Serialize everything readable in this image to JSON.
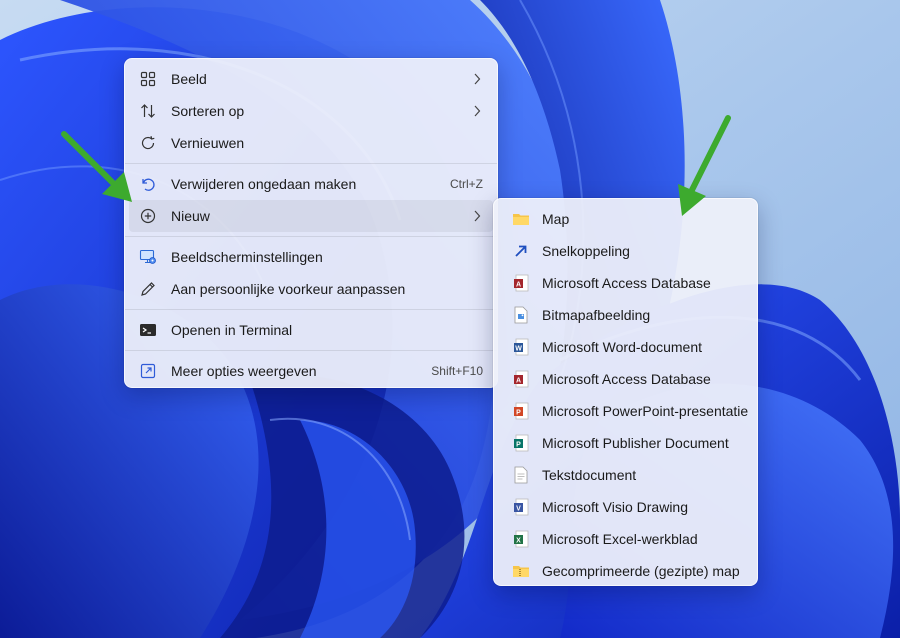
{
  "context_menu": {
    "items": [
      {
        "label": "Beeld",
        "icon": "grid-icon",
        "has_submenu": true
      },
      {
        "label": "Sorteren op",
        "icon": "sort-icon",
        "has_submenu": true
      },
      {
        "label": "Vernieuwen",
        "icon": "refresh-icon"
      },
      {
        "label": "Verwijderen ongedaan maken",
        "icon": "undo-icon",
        "shortcut": "Ctrl+Z"
      },
      {
        "label": "Nieuw",
        "icon": "add-circle-icon",
        "has_submenu": true
      },
      {
        "label": "Beeldscherminstellingen",
        "icon": "display-settings-icon"
      },
      {
        "label": "Aan persoonlijke voorkeur aanpassen",
        "icon": "pencil-icon"
      },
      {
        "label": "Openen in Terminal",
        "icon": "terminal-icon"
      },
      {
        "label": "Meer opties weergeven",
        "icon": "more-options-icon",
        "shortcut": "Shift+F10"
      }
    ]
  },
  "new_submenu": {
    "items": [
      {
        "label": "Map",
        "icon": "folder-icon"
      },
      {
        "label": "Snelkoppeling",
        "icon": "shortcut-icon"
      },
      {
        "label": "Microsoft Access Database",
        "icon": "access-icon"
      },
      {
        "label": "Bitmapafbeelding",
        "icon": "bitmap-icon"
      },
      {
        "label": "Microsoft Word-document",
        "icon": "word-icon"
      },
      {
        "label": "Microsoft Access Database",
        "icon": "access-icon"
      },
      {
        "label": "Microsoft PowerPoint-presentatie",
        "icon": "powerpoint-icon"
      },
      {
        "label": "Microsoft Publisher Document",
        "icon": "publisher-icon"
      },
      {
        "label": "Tekstdocument",
        "icon": "text-document-icon"
      },
      {
        "label": "Microsoft Visio Drawing",
        "icon": "visio-icon"
      },
      {
        "label": "Microsoft Excel-werkblad",
        "icon": "excel-icon"
      },
      {
        "label": "Gecomprimeerde (gezipte) map",
        "icon": "zip-folder-icon"
      }
    ]
  },
  "colors": {
    "wallpaper_blue": "#1a3de0",
    "annotation_arrow": "#3daa2e",
    "menu_background": "#eef0fa"
  }
}
